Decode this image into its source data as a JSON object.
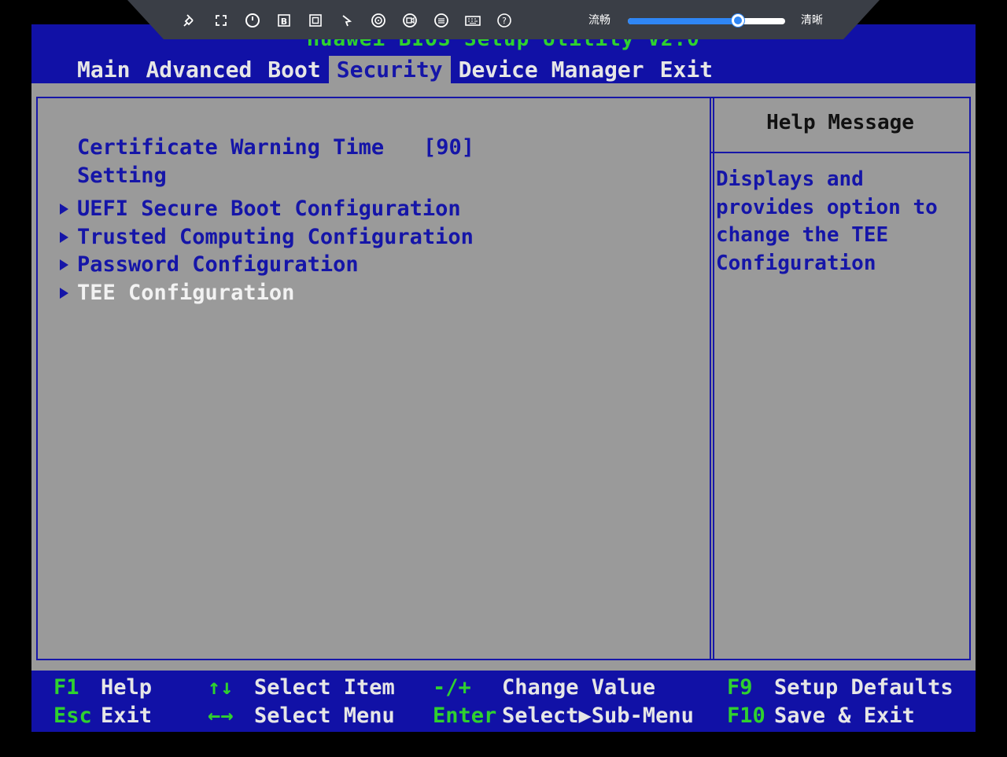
{
  "bios": {
    "title": "Huawei BIOS Setup Utility V2.0",
    "tabs": [
      "Main",
      "Advanced",
      "Boot",
      "Security",
      "Device Manager",
      "Exit"
    ],
    "active_tab": "Security",
    "items": {
      "cert_warning_label_1": "Certificate Warning Time",
      "cert_warning_label_2": "Setting",
      "cert_warning_value": "[90]",
      "uefi_secure_boot": "UEFI Secure Boot Configuration",
      "trusted_computing": "Trusted Computing Configuration",
      "password_config": "Password Configuration",
      "tee_config": "TEE Configuration"
    },
    "selected_item": "TEE Configuration",
    "help": {
      "title": "Help Message",
      "body": "Displays and\nprovides option to\nchange the TEE\nConfiguration"
    },
    "footer": {
      "f1_key": "F1",
      "f1_desc": "Help",
      "esc_key": "Esc",
      "esc_desc": "Exit",
      "updown_key": "↑↓",
      "updown_desc": "Select Item",
      "leftright_key": "←→",
      "leftright_desc": "Select Menu",
      "change_key": "-/+",
      "change_desc": "Change Value",
      "enter_key": "Enter",
      "enter_desc": "Select▶Sub-Menu",
      "f9_key": "F9",
      "f9_desc": "Setup Defaults",
      "f10_key": "F10",
      "f10_desc": "Save & Exit"
    }
  },
  "toolbar": {
    "icons": [
      "pin-icon",
      "fullscreen-icon",
      "power-icon",
      "b-icon",
      "screenshot-icon",
      "mouse-icon",
      "disc-icon",
      "record-icon",
      "menu-icon",
      "keyboard-icon",
      "help-icon"
    ],
    "quality_low_label": "流畅",
    "quality_high_label": "清晰",
    "quality_level": 0.7
  },
  "colors": {
    "bios_blue": "#1111a6",
    "bios_gray": "#9a9a9a",
    "bios_green": "#2fd12f",
    "toolbar_bg": "#3a3e46",
    "slider_accent": "#2f86f5"
  }
}
